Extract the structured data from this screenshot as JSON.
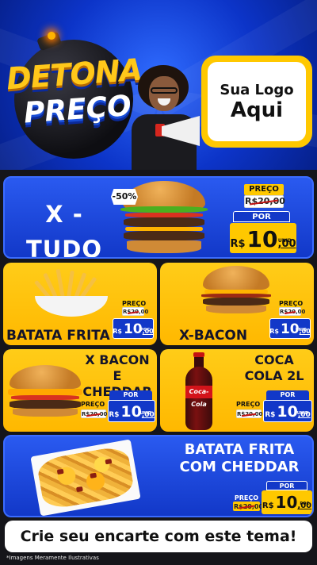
{
  "header": {
    "brand_line1": "DETONA",
    "brand_line2": "PREÇO",
    "logo_line1": "Sua Logo",
    "logo_line2": "Aqui",
    "colors": {
      "brand_yellow": "#ffc81a",
      "blue": "#1238c8"
    }
  },
  "featured": {
    "name_line1": "X -",
    "name_line2": "TUDO",
    "discount": "-50%",
    "price_label": "PREÇO",
    "old_price": "R$20,00",
    "por_label": "POR",
    "currency": "R$",
    "price": "10",
    "cents": ",00",
    "unit": "UNID"
  },
  "products": [
    {
      "name": "BATATA FRITA",
      "price_label": "PREÇO",
      "old_price": "R$20,00",
      "currency": "R$",
      "price": "10",
      "cents": ",00",
      "unit": "POC",
      "icon": "fries-icon"
    },
    {
      "name": "X-BACON",
      "price_label": "PREÇO",
      "old_price": "R$20,00",
      "currency": "R$",
      "price": "10",
      "cents": ",00",
      "unit": "UNID",
      "icon": "burger-icon"
    },
    {
      "name_line1": "X BACON E",
      "name_line2": "CHEDDAR",
      "price_label": "PREÇO",
      "old_price": "R$20,00",
      "por_label": "POR",
      "currency": "R$",
      "price": "10",
      "cents": ",00",
      "unit": "UNID",
      "icon": "burger-icon"
    },
    {
      "name_line1": "COCA",
      "name_line2": "COLA 2L",
      "price_label": "PREÇO",
      "old_price": "R$20,00",
      "por_label": "POR",
      "currency": "R$",
      "price": "10",
      "cents": ",00",
      "unit": "UNID",
      "icon": "soda-bottle-icon",
      "bottle_text": "Coca-Cola"
    },
    {
      "name_line1": "BATATA FRITA",
      "name_line2": "COM CHEDDAR",
      "price_label": "PREÇO",
      "old_price": "R$20,00",
      "por_label": "POR",
      "currency": "R$",
      "price": "10",
      "cents": ",00",
      "unit": "POC",
      "icon": "fries-tray-icon"
    }
  ],
  "cta": "Crie seu encarte com este tema!",
  "footnote": "*Imagens Meramente Ilustrativas"
}
